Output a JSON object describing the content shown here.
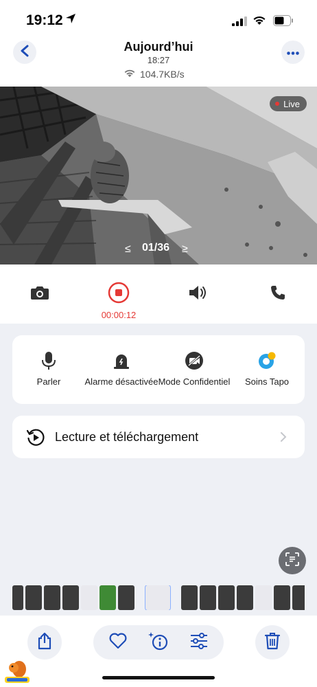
{
  "status_bar": {
    "time": "19:12",
    "icons": [
      "location-arrow-icon",
      "cellular-signal-icon",
      "wifi-icon",
      "battery-icon"
    ]
  },
  "header": {
    "title": "Aujourd’hui",
    "time": "18:27",
    "speed": "104.7KB/s",
    "icons": [
      "back-chevron-icon",
      "more-dots-icon",
      "wifi-icon"
    ]
  },
  "video": {
    "live_label": "Live",
    "prev_label": "≤",
    "counter": "01/36",
    "next_label": "≥"
  },
  "controls": {
    "icons": [
      "camera-icon",
      "record-stop-icon",
      "speaker-icon",
      "phone-icon"
    ],
    "record_time": "00:00:12",
    "accent": "#e53935"
  },
  "features": [
    {
      "label": "Parler",
      "icon": "microphone-icon"
    },
    {
      "label": "Alarme désactivée",
      "icon": "alarm-siren-icon"
    },
    {
      "label": "Mode Confidentiel",
      "icon": "camera-off-icon"
    },
    {
      "label": "Soins Tapo",
      "icon": "tapo-care-icon"
    }
  ],
  "playback": {
    "label": "Lecture et téléchargement",
    "icon": "history-play-icon"
  },
  "bottom_bar": {
    "icons": [
      "share-icon",
      "heart-icon",
      "info-sparkle-icon",
      "sliders-icon",
      "trash-icon"
    ],
    "brand_color": "#1e4db7"
  }
}
